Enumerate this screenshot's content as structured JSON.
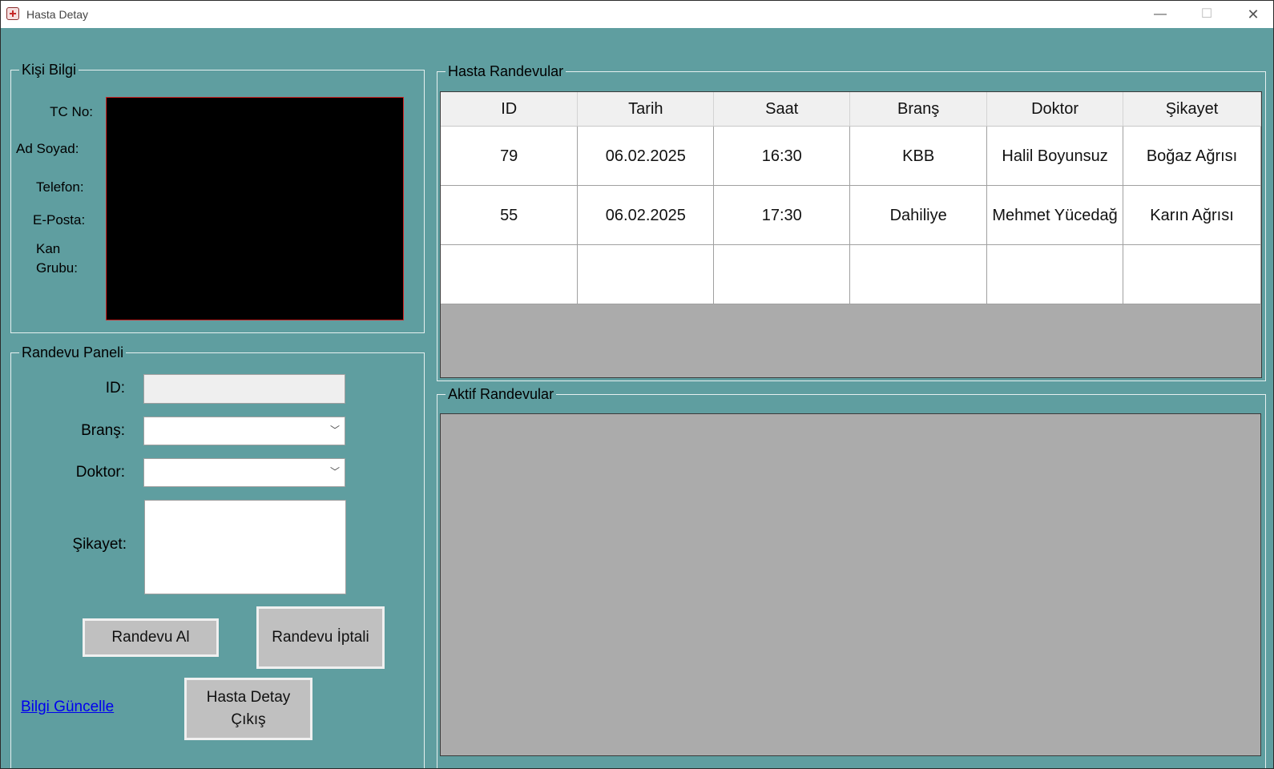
{
  "window": {
    "title": "Hasta Detay",
    "controls": {
      "minimize": "—",
      "maximize": "☐",
      "close": "✕"
    }
  },
  "kisi_bilgi": {
    "legend": "Kişi Bilgi",
    "labels": {
      "tc": "TC No:",
      "ad_soyad": "Ad Soyad:",
      "telefon": "Telefon:",
      "eposta": "E-Posta:",
      "kan_grubu": "Kan\nGrubu:"
    }
  },
  "randevu_paneli": {
    "legend": "Randevu Paneli",
    "labels": {
      "id": "ID:",
      "brans": "Branş:",
      "doktor": "Doktor:",
      "sikayet": "Şikayet:"
    },
    "values": {
      "id": "",
      "brans": "",
      "doktor": "",
      "sikayet": ""
    },
    "buttons": {
      "randevu_al": "Randevu Al",
      "randevu_iptali": "Randevu İptali",
      "cikis": "Hasta Detay\nÇıkış"
    },
    "link": "Bilgi Güncelle"
  },
  "hasta_randevular": {
    "legend": "Hasta Randevular",
    "columns": [
      "ID",
      "Tarih",
      "Saat",
      "Branş",
      "Doktor",
      "Şikayet"
    ],
    "rows": [
      [
        "79",
        "06.02.2025",
        "16:30",
        "KBB",
        "Halil Boyunsuz",
        "Boğaz Ağrısı"
      ],
      [
        "55",
        "06.02.2025",
        "17:30",
        "Dahiliye",
        "Mehmet Yücedağ",
        "Karın Ağrısı"
      ],
      [
        "",
        "",
        "",
        "",
        "",
        ""
      ]
    ]
  },
  "aktif_randevular": {
    "legend": "Aktif Randevular"
  },
  "colors": {
    "background": "#5f9ea0",
    "grid_empty": "#ababab",
    "link": "#0000ee"
  }
}
